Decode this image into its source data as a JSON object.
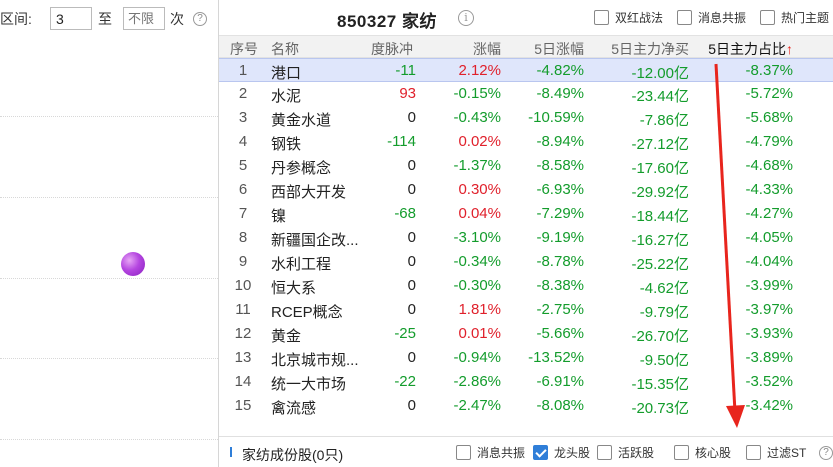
{
  "left_panel": {
    "interval_label": "区间:",
    "from_value": "3",
    "to_label": "至",
    "to_placeholder": "不限",
    "times_label": "次",
    "help_glyph": "?"
  },
  "header": {
    "title": "850327 家纺",
    "info_glyph": "i",
    "checkboxes": [
      {
        "label": "双红战法",
        "checked": false
      },
      {
        "label": "消息共振",
        "checked": false
      },
      {
        "label": "热门主题",
        "checked": false
      }
    ]
  },
  "table": {
    "columns": [
      "序号",
      "名称",
      "度脉冲",
      "涨幅",
      "5日涨幅",
      "5日主力净买",
      "5日主力占比"
    ],
    "sort_indicator": "↑",
    "rows": [
      {
        "idx": "1",
        "name": "港口",
        "ma": "-11",
        "zf": "2.12%",
        "zf5": "-4.82%",
        "net5": "-12.00亿",
        "pct5": "-8.37%"
      },
      {
        "idx": "2",
        "name": "水泥",
        "ma": "93",
        "zf": "-0.15%",
        "zf5": "-8.49%",
        "net5": "-23.44亿",
        "pct5": "-5.72%"
      },
      {
        "idx": "3",
        "name": "黄金水道",
        "ma": "0",
        "zf": "-0.43%",
        "zf5": "-10.59%",
        "net5": "-7.86亿",
        "pct5": "-5.68%"
      },
      {
        "idx": "4",
        "name": "钢铁",
        "ma": "-114",
        "zf": "0.02%",
        "zf5": "-8.94%",
        "net5": "-27.12亿",
        "pct5": "-4.79%"
      },
      {
        "idx": "5",
        "name": "丹参概念",
        "ma": "0",
        "zf": "-1.37%",
        "zf5": "-8.58%",
        "net5": "-17.60亿",
        "pct5": "-4.68%"
      },
      {
        "idx": "6",
        "name": "西部大开发",
        "ma": "0",
        "zf": "0.30%",
        "zf5": "-6.93%",
        "net5": "-29.92亿",
        "pct5": "-4.33%"
      },
      {
        "idx": "7",
        "name": "镍",
        "ma": "-68",
        "zf": "0.04%",
        "zf5": "-7.29%",
        "net5": "-18.44亿",
        "pct5": "-4.27%"
      },
      {
        "idx": "8",
        "name": "新疆国企改...",
        "ma": "0",
        "zf": "-3.10%",
        "zf5": "-9.19%",
        "net5": "-16.27亿",
        "pct5": "-4.05%"
      },
      {
        "idx": "9",
        "name": "水利工程",
        "ma": "0",
        "zf": "-0.34%",
        "zf5": "-8.78%",
        "net5": "-25.22亿",
        "pct5": "-4.04%"
      },
      {
        "idx": "10",
        "name": "恒大系",
        "ma": "0",
        "zf": "-0.30%",
        "zf5": "-8.38%",
        "net5": "-4.62亿",
        "pct5": "-3.99%"
      },
      {
        "idx": "11",
        "name": "RCEP概念",
        "ma": "0",
        "zf": "1.81%",
        "zf5": "-2.75%",
        "net5": "-9.79亿",
        "pct5": "-3.97%"
      },
      {
        "idx": "12",
        "name": "黄金",
        "ma": "-25",
        "zf": "0.01%",
        "zf5": "-5.66%",
        "net5": "-26.70亿",
        "pct5": "-3.93%"
      },
      {
        "idx": "13",
        "name": "北京城市规...",
        "ma": "0",
        "zf": "-0.94%",
        "zf5": "-13.52%",
        "net5": "-9.50亿",
        "pct5": "-3.89%"
      },
      {
        "idx": "14",
        "name": "统一大市场",
        "ma": "-22",
        "zf": "-2.86%",
        "zf5": "-6.91%",
        "net5": "-15.35亿",
        "pct5": "-3.52%"
      },
      {
        "idx": "15",
        "name": "禽流感",
        "ma": "0",
        "zf": "-2.47%",
        "zf5": "-8.08%",
        "net5": "-20.73亿",
        "pct5": "-3.42%"
      }
    ]
  },
  "footer": {
    "label": "家纺成份股(0只)",
    "checkboxes": [
      {
        "label": "消息共振",
        "checked": false
      },
      {
        "label": "龙头股",
        "checked": true
      },
      {
        "label": "活跃股",
        "checked": false
      },
      {
        "label": "核心股",
        "checked": false
      },
      {
        "label": "过滤ST",
        "checked": false
      }
    ],
    "help_glyph": "?"
  },
  "colors": {
    "up": "#e0202b",
    "down": "#139c2c",
    "neutral": "#222222",
    "selected_row": "#dfe6fb",
    "arrow": "#e8251d",
    "accent": "#2f7ed8"
  }
}
